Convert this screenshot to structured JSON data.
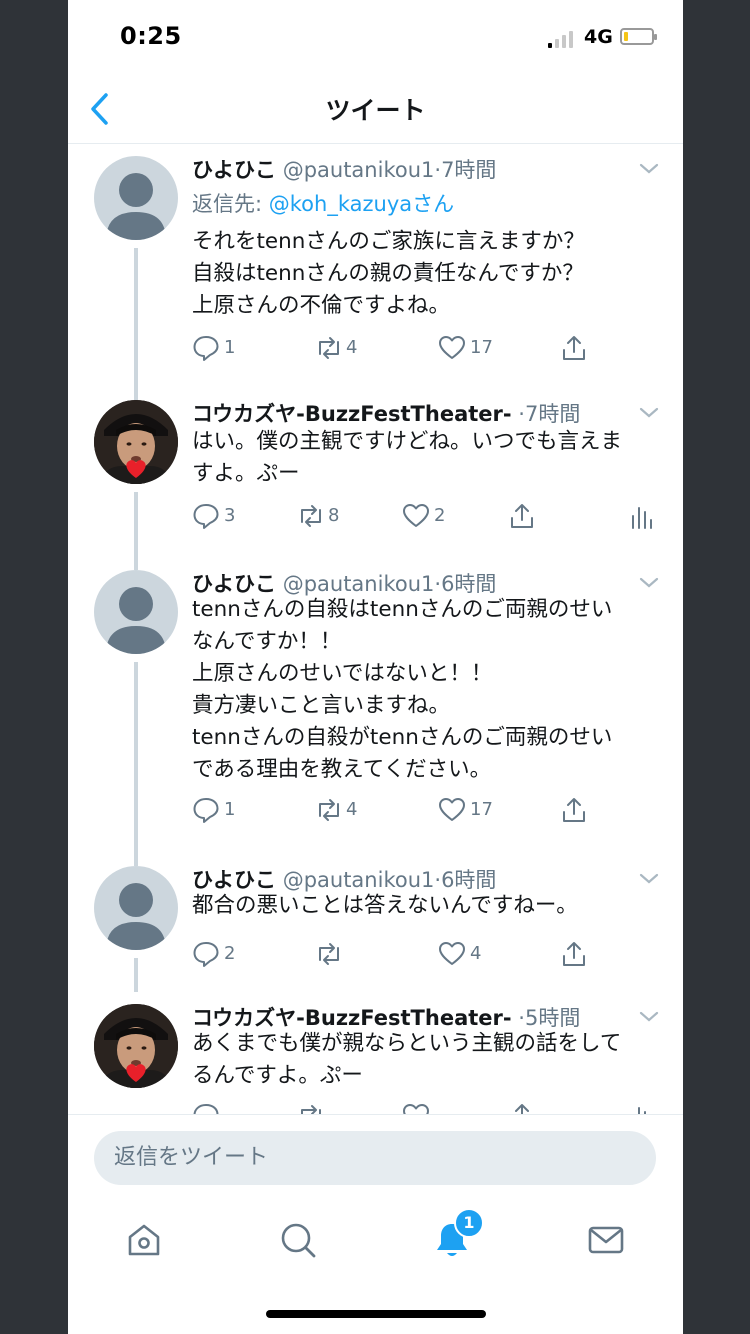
{
  "status": {
    "time": "0:25",
    "network": "4G"
  },
  "header": {
    "title": "ツイート"
  },
  "tweets": [
    {
      "name": "ひよひこ",
      "handle": "@pautanikou1",
      "sep": "·",
      "age": "7時間",
      "reply_prefix": "返信先: ",
      "reply_user": "@koh_kazuyaさん",
      "lines": [
        "それをtennさんのご家族に言えますか？",
        "自殺はtennさんの親の責任なんですか？",
        "上原さんの不倫ですよね。"
      ],
      "replies": "1",
      "retweets": "4",
      "likes": "17"
    },
    {
      "name": "コウカズヤ-BuzzFestTheater-",
      "sep": "·",
      "age": "7時間",
      "lines": [
        "はい。僕の主観ですけどね。いつでも言えま",
        "すよ。ぷー"
      ],
      "replies": "3",
      "retweets": "8",
      "likes": "2"
    },
    {
      "name": "ひよひこ",
      "handle": "@pautanikou1",
      "sep": "·",
      "age": "6時間",
      "lines": [
        "tennさんの自殺はtennさんのご両親のせい",
        "なんですか！！",
        "上原さんのせいではないと！！",
        "貴方凄いこと言いますね。",
        "tennさんの自殺がtennさんのご両親のせい",
        "である理由を教えてください。"
      ],
      "replies": "1",
      "retweets": "4",
      "likes": "17"
    },
    {
      "name": "ひよひこ",
      "handle": "@pautanikou1",
      "sep": "·",
      "age": "6時間",
      "lines": [
        "都合の悪いことは答えないんですねー。"
      ],
      "replies": "2",
      "retweets": "",
      "likes": "4"
    },
    {
      "name": "コウカズヤ-BuzzFestTheater-",
      "sep": "·",
      "age": "5時間",
      "lines": [
        "あくまでも僕が親ならという主観の話をして",
        "るんですよ。ぷー"
      ]
    }
  ],
  "reply_bar": {
    "placeholder": "返信をツイート"
  },
  "tabbar": {
    "notifications_badge": "1"
  },
  "colors": {
    "accent": "#1da1f2",
    "secondary_text": "#657786",
    "thread_line": "#ccd6dd"
  }
}
